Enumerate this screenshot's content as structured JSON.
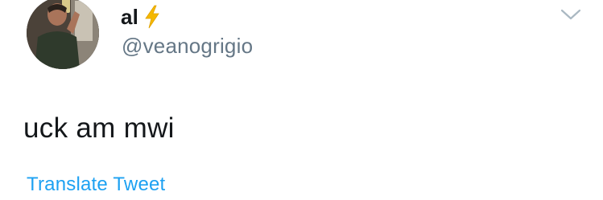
{
  "user": {
    "display_name": "al",
    "handle": "@veanogrigio",
    "avatar_icon": "profile-photo",
    "name_badge_icon": "lightning-bolt-icon"
  },
  "tweet": {
    "text": "uck am mwi",
    "translate_label": "Translate Tweet"
  },
  "colors": {
    "primary_text": "#14171a",
    "secondary_text": "#657786",
    "link": "#1da1f2",
    "bolt": "#f5b800",
    "chevron": "#aab8c2"
  }
}
